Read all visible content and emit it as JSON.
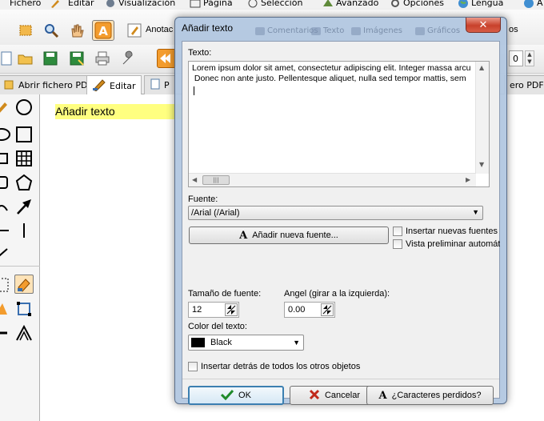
{
  "menu": {
    "items": [
      {
        "label": "Fichero",
        "icon": "file-icon"
      },
      {
        "label": "Editar",
        "icon": "edit-icon"
      },
      {
        "label": "Visualización",
        "icon": "view-icon"
      },
      {
        "label": "Página",
        "icon": "page-icon"
      },
      {
        "label": "Selección",
        "icon": "selection-icon"
      },
      {
        "label": "Avanzado",
        "icon": "advanced-icon"
      },
      {
        "label": "Opciones",
        "icon": "options-icon"
      },
      {
        "label": "Lengua",
        "icon": "globe-icon"
      },
      {
        "label": "A",
        "icon": "help-icon"
      }
    ]
  },
  "toolbar": {
    "annotate_label": "Anotac",
    "right_label": "os",
    "spin_value": "0"
  },
  "tabs": {
    "open_pdf": "Abrir fichero PDF",
    "edit": "Editar",
    "partial": "P",
    "right": "ero PDF"
  },
  "canvas": {
    "text_box": "Añadir texto"
  },
  "dialog": {
    "title": "Añadir texto",
    "ghost_items": [
      "Comentarios",
      "Texto",
      "Imágenes",
      "Gráficos"
    ],
    "text_label": "Texto:",
    "text_value": "Lorem ipsum dolor sit amet, consectetur adipiscing elit. Integer massa arcu\n Donec non ante justo. Pellentesque aliquet, nulla sed tempor mattis, sem",
    "font_label": "Fuente:",
    "font_value": "/Arial (/Arial)",
    "add_font_button": "Añadir nueva fuente...",
    "insert_new_fonts": "Insertar nuevas fuentes",
    "preview_auto": "Vista preliminar automática",
    "font_size_label": "Tamaño de fuente:",
    "font_size_value": "12",
    "angle_label": "Angel (girar a la izquierda):",
    "angle_value": "0.00",
    "color_label": "Color del texto:",
    "color_value": "Black",
    "behind_label": "Insertar detrás de todos los otros objetos",
    "ok_button": "OK",
    "cancel_button": "Cancelar",
    "missing_chars_button": "¿Caracteres perdidos?"
  },
  "colors": {
    "text_highlight": "#ffff80",
    "accent_blue": "#3c7fb1",
    "close_red": "#c8412b"
  }
}
